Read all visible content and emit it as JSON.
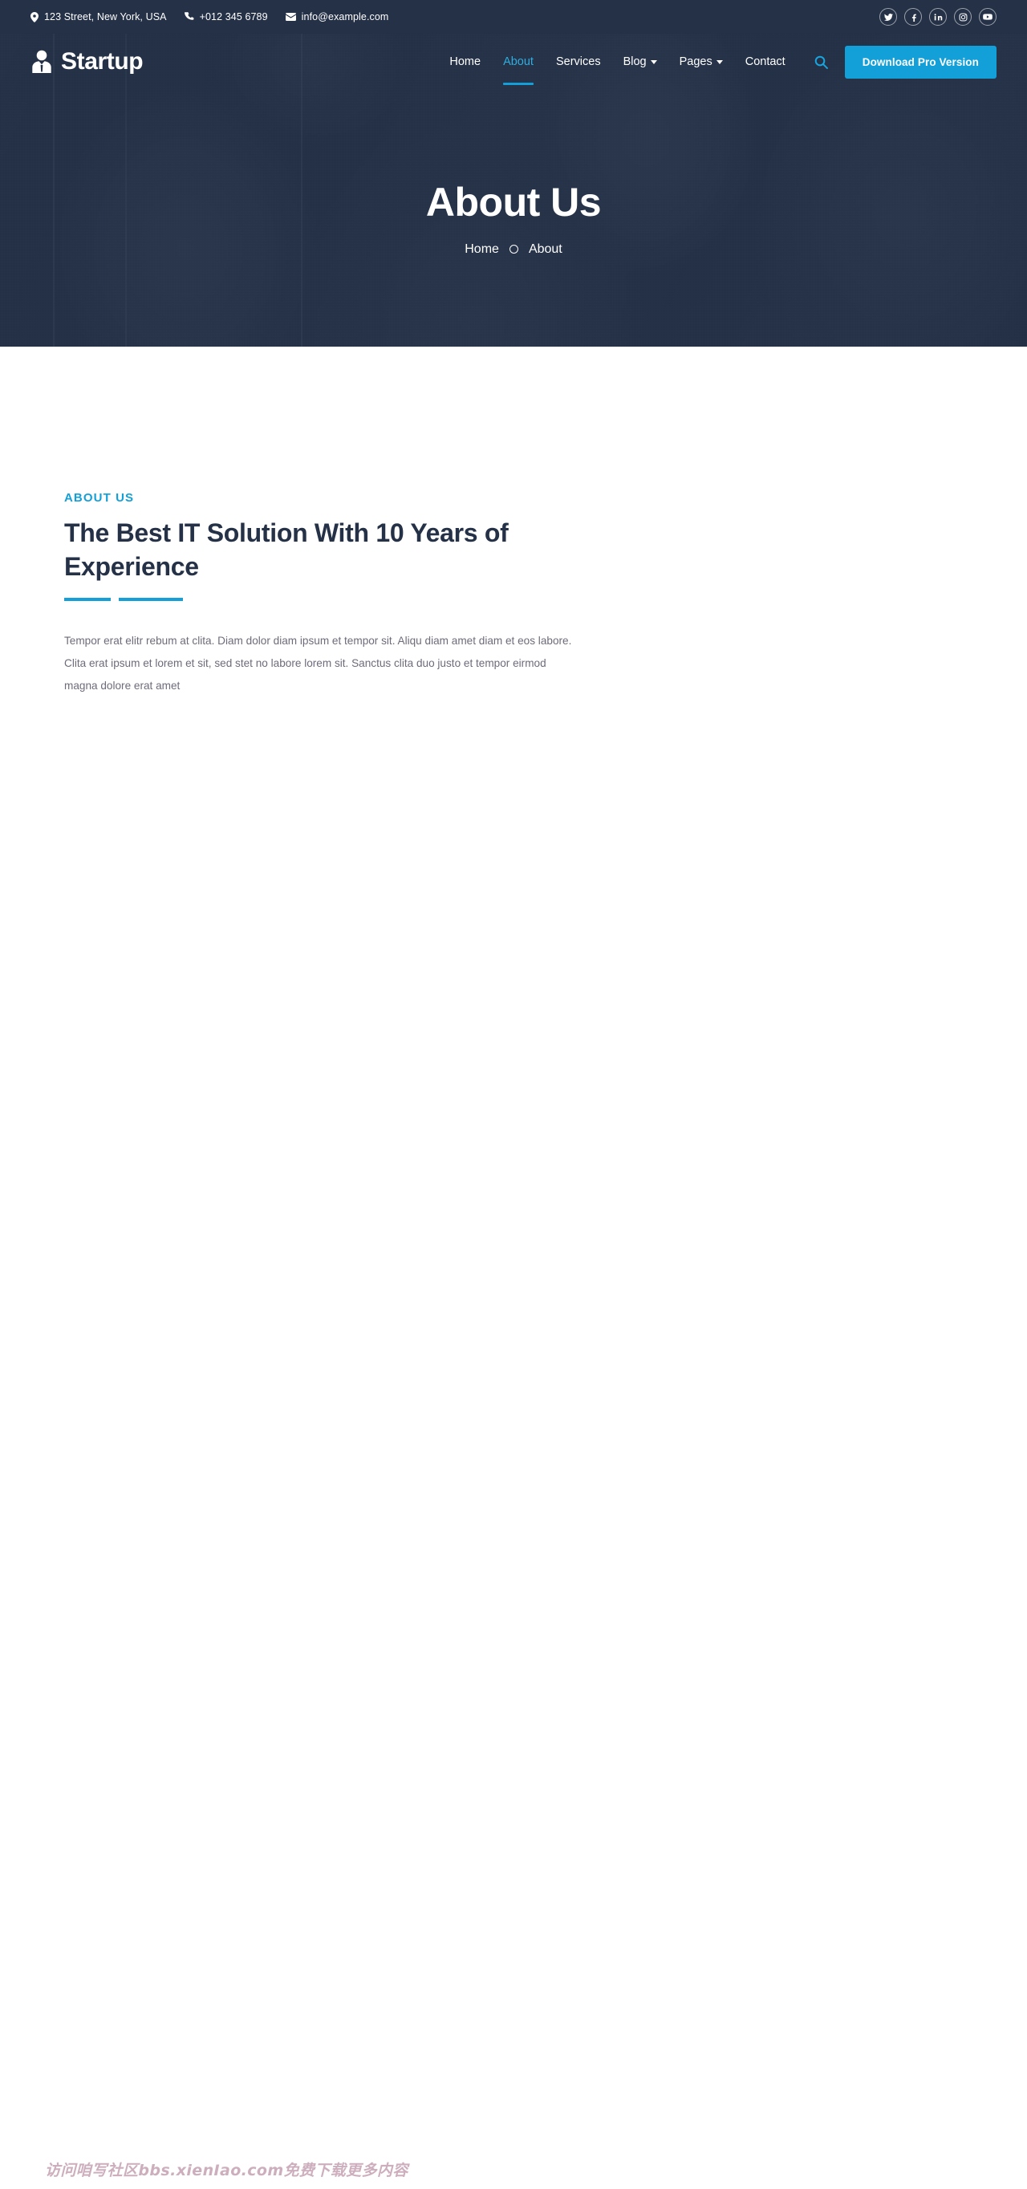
{
  "colors": {
    "accent": "#13a0d9",
    "accent_light": "#2eaee0",
    "dark_navy": "#253147",
    "body_text": "#6e6b7a",
    "white": "#ffffff"
  },
  "topbar": {
    "address": "123 Street, New York, USA",
    "phone": "+012 345 6789",
    "email": "info@example.com",
    "icons": {
      "address": "map-marker-icon",
      "phone": "phone-icon",
      "email": "envelope-icon"
    },
    "social": [
      {
        "name": "twitter-icon",
        "label": "Twitter"
      },
      {
        "name": "facebook-icon",
        "label": "Facebook"
      },
      {
        "name": "linkedin-icon",
        "label": "LinkedIn"
      },
      {
        "name": "instagram-icon",
        "label": "Instagram"
      },
      {
        "name": "youtube-icon",
        "label": "YouTube"
      }
    ]
  },
  "navbar": {
    "brand": "Startup",
    "brand_icon": "user-tie-icon",
    "menu": [
      {
        "label": "Home",
        "active": false,
        "dropdown": false
      },
      {
        "label": "About",
        "active": true,
        "dropdown": false
      },
      {
        "label": "Services",
        "active": false,
        "dropdown": false
      },
      {
        "label": "Blog",
        "active": false,
        "dropdown": true
      },
      {
        "label": "Pages",
        "active": false,
        "dropdown": true
      },
      {
        "label": "Contact",
        "active": false,
        "dropdown": false
      }
    ],
    "search_icon": "search-icon",
    "cta_label": "Download Pro Version"
  },
  "hero": {
    "title": "About Us",
    "breadcrumb": {
      "home": "Home",
      "separator": "circle-icon",
      "current": "About"
    }
  },
  "about": {
    "eyebrow": "ABOUT US",
    "heading": "The Best IT Solution With 10 Years of Experience",
    "body": "Tempor erat elitr rebum at clita. Diam dolor diam ipsum et tempor sit. Aliqu diam amet diam et eos labore. Clita erat ipsum et lorem et sit, sed stet no labore lorem sit. Sanctus clita duo justo et tempor eirmod magna dolore erat amet"
  },
  "watermark": {
    "text": "访问咱写社区bbs.xienIao.com免费下载更多内容"
  }
}
